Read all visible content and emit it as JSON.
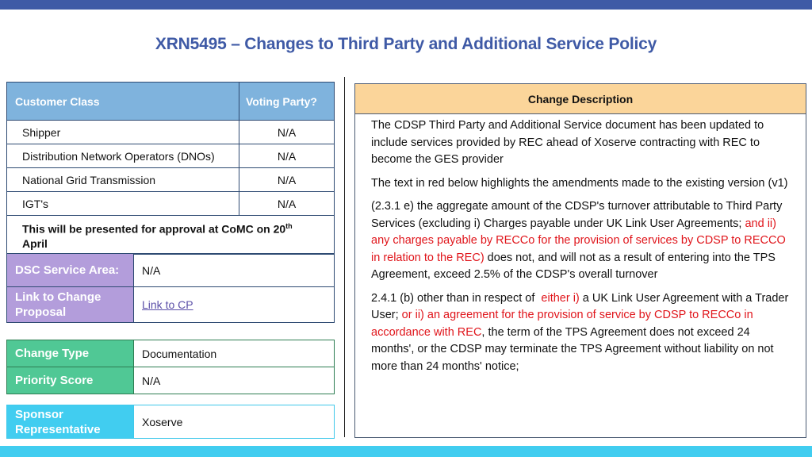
{
  "title": "XRN5495 – Changes to Third Party and Additional Service Policy",
  "colors": {
    "top_bar": "#3f5aa6",
    "bottom_bar": "#41cdf0",
    "customer_header": "#7fb3dd",
    "dsc_label": "#b39ddb",
    "change_type_label": "#50c895",
    "sponsor_label": "#41cdf0",
    "desc_header": "#fbd59a",
    "amendment_text": "#e0151b"
  },
  "customer_table": {
    "headers": [
      "Customer Class",
      "Voting Party?"
    ],
    "rows": [
      {
        "class": "Shipper",
        "voting": "N/A"
      },
      {
        "class": "Distribution Network Operators (DNOs)",
        "voting": "N/A"
      },
      {
        "class": "National Grid Transmission",
        "voting": "N/A"
      },
      {
        "class": "IGT's",
        "voting": "N/A"
      }
    ],
    "note_main": "This will be presented for approval at CoMC on 20",
    "note_sup": "th",
    "note_end": "April"
  },
  "dsc": {
    "service_area_label": "DSC Service Area:",
    "service_area_value": "N/A",
    "link_label": "Link to Change Proposal",
    "link_text": "Link to CP"
  },
  "change": {
    "type_label": "Change Type",
    "type_value": "Documentation",
    "priority_label": "Priority Score",
    "priority_value": "N/A"
  },
  "sponsor": {
    "label": "Sponsor Representative",
    "value": "Xoserve"
  },
  "description": {
    "header": "Change Description",
    "p1": "The CDSP Third Party and Additional Service document has been updated to include services provided by REC ahead of Xoserve contracting with REC to become the GES provider",
    "p2": "The text in red below highlights the amendments made to the existing version (v1)",
    "p3_a": "(2.3.1 e) the aggregate amount of the CDSP's turnover attributable to Third Party Services (excluding i) Charges payable under UK Link User Agreements; ",
    "p3_red": "and ii) any charges payable by RECCo for the provision of services by CDSP to RECCO in relation to the REC)",
    "p3_b": " does not, and will not as a result of entering into the TPS Agreement, exceed 2.5% of the CDSP's overall turnover",
    "p4_a": "2.4.1 (b) other than in respect of  ",
    "p4_red1": "either i)",
    "p4_b": " a UK Link User Agreement with a Trader User; ",
    "p4_red2": "or ii) an agreement for the provision of service by CDSP to RECCo in accordance with REC",
    "p4_c": ", the term of the TPS Agreement does not exceed 24 months', or the CDSP may terminate the TPS Agreement without liability on not more than 24 months' notice;"
  }
}
